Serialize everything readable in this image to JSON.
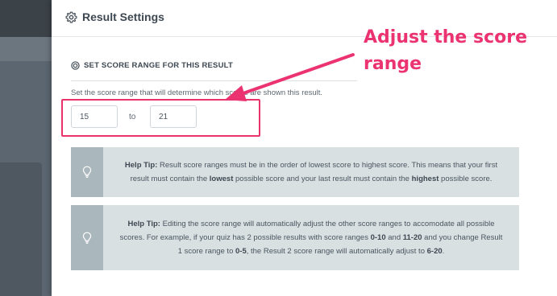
{
  "panel": {
    "title": "Result Settings",
    "icon": "gear-icon"
  },
  "section": {
    "title": "SET SCORE RANGE FOR THIS RESULT",
    "icon": "target-icon",
    "description": "Set the score range that will determine which scores are shown this result."
  },
  "range": {
    "from_value": "15",
    "to_label": "to",
    "to_value": "21"
  },
  "tips": [
    {
      "icon": "lightbulb-icon",
      "label": "Help Tip:",
      "text_before": " Result score ranges must be in the order of lowest score to highest score. This means that your first result must contain the ",
      "bold1": "lowest",
      "text_middle": " possible score and your last result must contain the ",
      "bold2": "highest",
      "text_after": " possible score."
    },
    {
      "icon": "lightbulb-icon",
      "label": "Help Tip:",
      "text_a": " Editing the score range will automatically adjust the other score ranges to accomodate all possible scores. For example, if your quiz has 2 possible results with score ranges ",
      "bold_a": "0-10",
      "text_b": " and ",
      "bold_b": "11-20",
      "text_c": " and you change Result 1 score range to ",
      "bold_c": "0-5",
      "text_d": ", the Result 2 score range will automatically adjust to ",
      "bold_d": "6-20",
      "text_e": "."
    }
  ],
  "annotation": {
    "text": "Adjust the score range",
    "color": "#ec3372"
  },
  "colors": {
    "highlight_box": "#e8336a",
    "tip_background": "#d8e0e2",
    "tip_icon_background": "#aab7bd",
    "backdrop": "#5c6670"
  }
}
